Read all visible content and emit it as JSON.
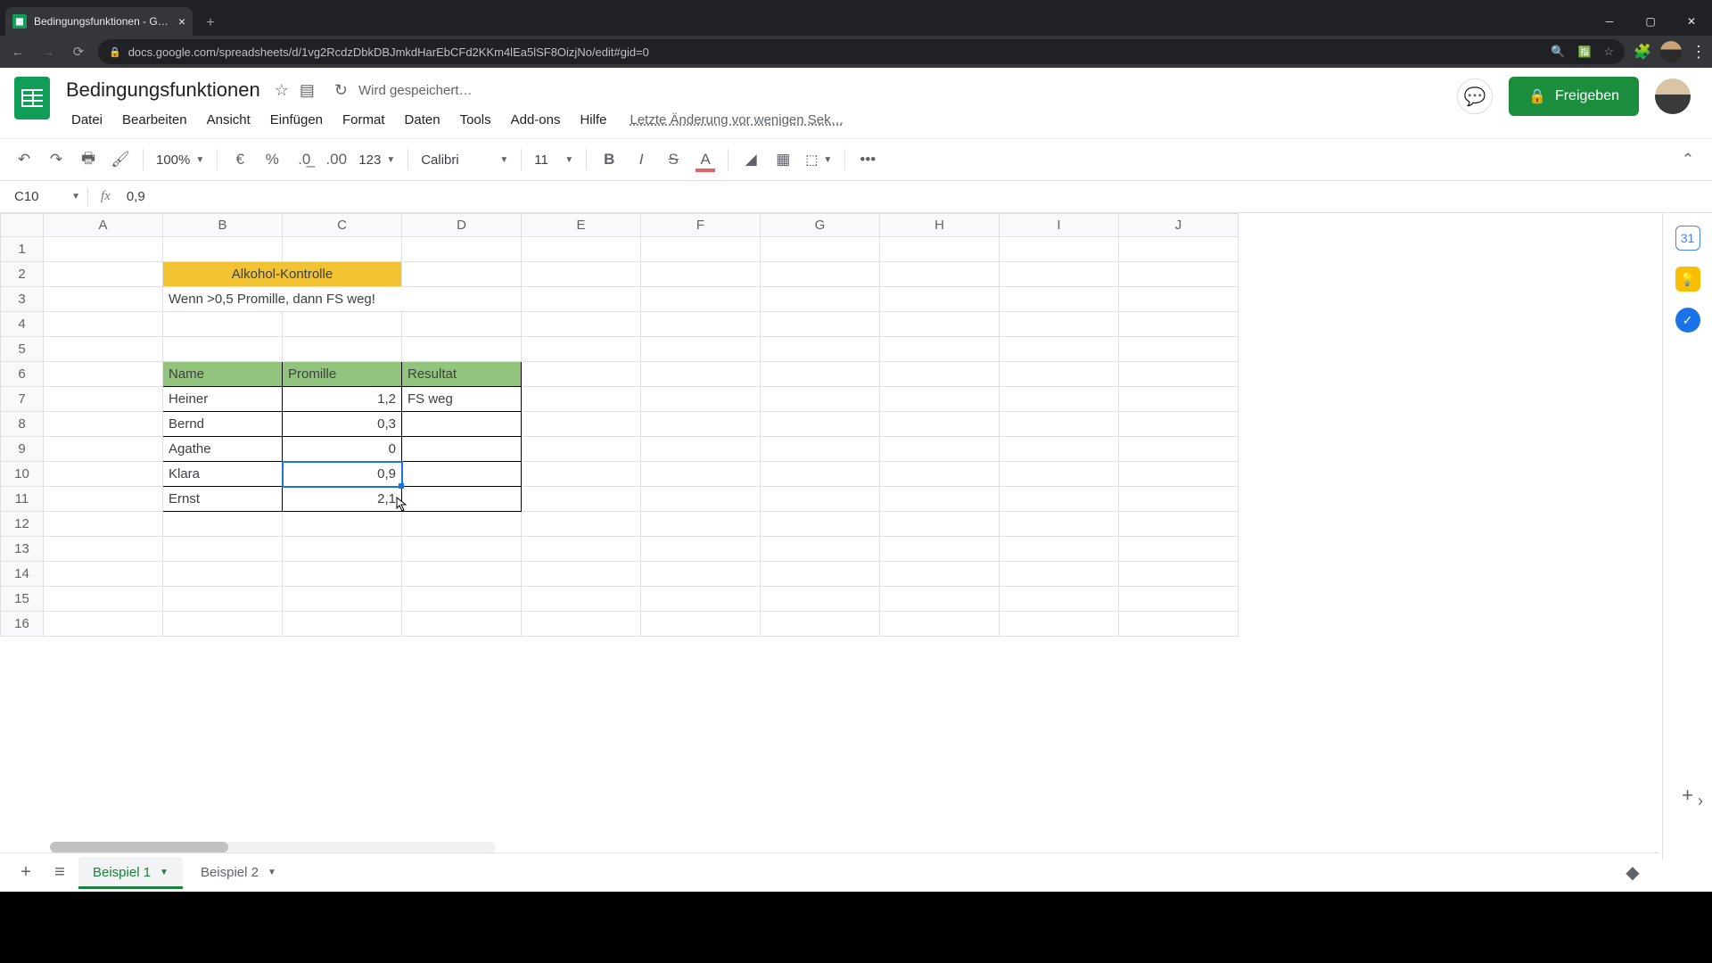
{
  "browser": {
    "tab_title": "Bedingungsfunktionen - Google",
    "url": "docs.google.com/spreadsheets/d/1vg2RcdzDbkDBJmkdHarEbCFd2KKm4lEa5lSF8OizjNo/edit#gid=0"
  },
  "doc": {
    "title": "Bedingungsfunktionen",
    "saving": "Wird gespeichert…",
    "last_edit": "Letzte Änderung vor wenigen Sek…",
    "share_label": "Freigeben"
  },
  "menus": {
    "file": "Datei",
    "edit": "Bearbeiten",
    "view": "Ansicht",
    "insert": "Einfügen",
    "format": "Format",
    "data": "Daten",
    "tools": "Tools",
    "addons": "Add-ons",
    "help": "Hilfe"
  },
  "toolbar": {
    "zoom": "100%",
    "currency": "€",
    "percent": "%",
    "format123": "123",
    "font": "Calibri",
    "font_size": "11",
    "more": "•••"
  },
  "namebox": {
    "ref": "C10",
    "formula": "0,9"
  },
  "columns": [
    "A",
    "B",
    "C",
    "D",
    "E",
    "F",
    "G",
    "H",
    "I",
    "J"
  ],
  "row_numbers": [
    "1",
    "2",
    "3",
    "4",
    "5",
    "6",
    "7",
    "8",
    "9",
    "10",
    "11",
    "12",
    "13",
    "14",
    "15",
    "16"
  ],
  "sheet": {
    "title_cell": "Alkohol-Kontrolle",
    "rule_text": "Wenn >0,5 Promille, dann FS weg!",
    "headers": {
      "name": "Name",
      "promille": "Promille",
      "result": "Resultat"
    },
    "rows": [
      {
        "name": "Heiner",
        "promille": "1,2",
        "result": "FS weg"
      },
      {
        "name": "Bernd",
        "promille": "0,3",
        "result": ""
      },
      {
        "name": "Agathe",
        "promille": "0",
        "result": ""
      },
      {
        "name": "Klara",
        "promille": "0,9",
        "result": ""
      },
      {
        "name": "Ernst",
        "promille": "2,1",
        "result": ""
      }
    ]
  },
  "tabs": {
    "tab1": "Beispiel 1",
    "tab2": "Beispiel 2"
  },
  "chart_data": {
    "type": "table",
    "title": "Alkohol-Kontrolle",
    "columns": [
      "Name",
      "Promille",
      "Resultat"
    ],
    "rows": [
      [
        "Heiner",
        "1,2",
        "FS weg"
      ],
      [
        "Bernd",
        "0,3",
        ""
      ],
      [
        "Agathe",
        "0",
        ""
      ],
      [
        "Klara",
        "0,9",
        ""
      ],
      [
        "Ernst",
        "2,1",
        ""
      ]
    ]
  }
}
